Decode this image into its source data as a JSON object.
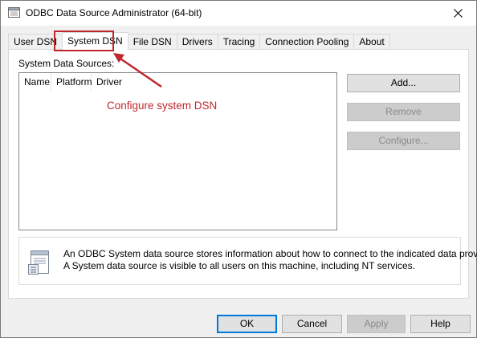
{
  "window": {
    "title": "ODBC Data Source Administrator (64-bit)",
    "close_glyph": "✕"
  },
  "tabs": [
    {
      "label": "User DSN",
      "active": false
    },
    {
      "label": "System DSN",
      "active": true
    },
    {
      "label": "File DSN",
      "active": false
    },
    {
      "label": "Drivers",
      "active": false
    },
    {
      "label": "Tracing",
      "active": false
    },
    {
      "label": "Connection Pooling",
      "active": false
    },
    {
      "label": "About",
      "active": false
    }
  ],
  "panel": {
    "group_label": "System Data Sources:",
    "columns": [
      "Name",
      "Platform",
      "Driver"
    ],
    "rows": []
  },
  "annotation": {
    "text": "Configure system DSN",
    "color": "#c0272d"
  },
  "side_buttons": {
    "add": "Add...",
    "remove": "Remove",
    "configure": "Configure..."
  },
  "info": {
    "line1": "An ODBC System data source stores information about how to connect to the indicated data provider.",
    "line2": "A System data source is visible to all users on this machine, including NT services."
  },
  "footer_buttons": {
    "ok": "OK",
    "cancel": "Cancel",
    "apply": "Apply",
    "help": "Help"
  },
  "icons": {
    "app": "odbc-app-icon",
    "info": "data-source-document-icon",
    "close": "close-icon"
  }
}
